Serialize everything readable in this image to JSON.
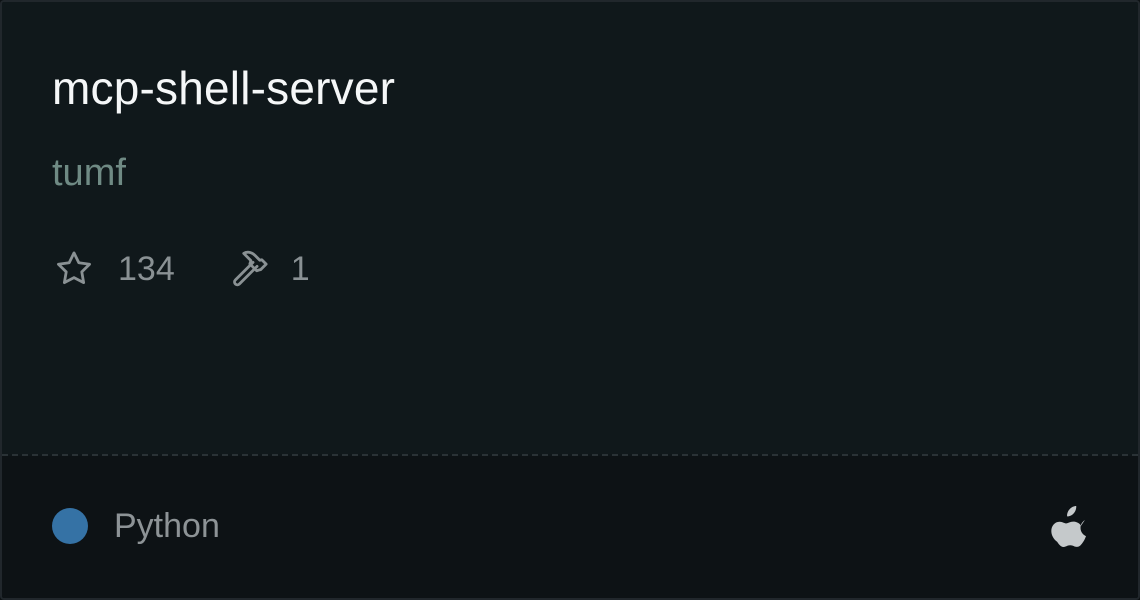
{
  "card": {
    "title": "mcp-shell-server",
    "author": "tumf",
    "stats": {
      "stars_icon": "star-icon",
      "stars": "134",
      "tools_icon": "hammer-icon",
      "tools": "1"
    },
    "footer": {
      "language": "Python",
      "language_color": "#3572a5",
      "platform_icon": "apple-icon"
    }
  }
}
